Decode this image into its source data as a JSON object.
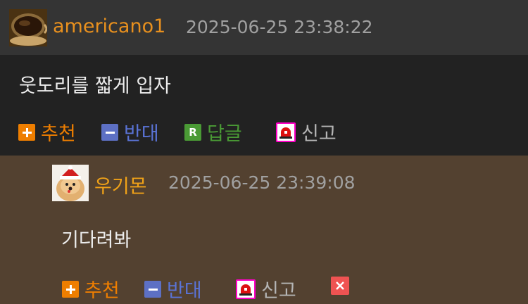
{
  "comments": [
    {
      "author": "americano1",
      "timestamp": "2025-06-25 23:38:22",
      "text": "웃도리를 짧게 입자",
      "actions": {
        "upvote": "추천",
        "downvote": "반대",
        "reply": "답글",
        "reply_icon": "R",
        "report": "신고"
      }
    },
    {
      "author": "우기몬",
      "timestamp": "2025-06-25 23:39:08",
      "text": "기다려봐",
      "actions": {
        "upvote": "추천",
        "downvote": "반대",
        "report": "신고"
      }
    }
  ],
  "icons": {
    "upvote": "plus-icon",
    "downvote": "minus-icon",
    "reply": "reply-icon",
    "report": "siren-icon",
    "delete": "close-icon"
  },
  "colors": {
    "author1": "#e8901e",
    "author2": "#f0a218",
    "upvote": "#ee7e00",
    "downvote": "#5a73d6",
    "reply": "#4a9a35",
    "report_icon": "#ff00c8",
    "delete": "#ef5352"
  }
}
